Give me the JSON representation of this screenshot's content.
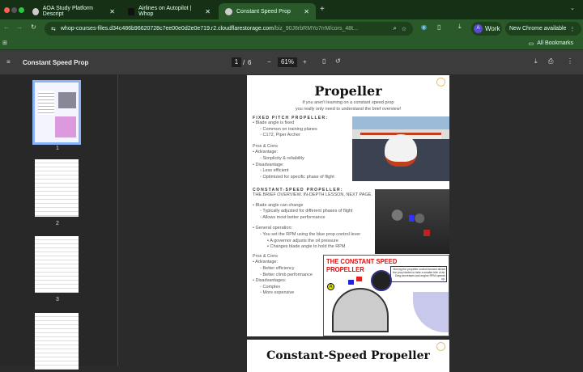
{
  "browser": {
    "tabs": [
      {
        "title": "AOA Study Platform Descript"
      },
      {
        "title": "Airlines on Autopilot | Whop"
      },
      {
        "title": "Constant Speed Prop"
      }
    ],
    "url": "whop-courses-files.d34c486b96620728c7ee00e0d2e0e719.r2.cloudflarestorage.com",
    "url_rest": "/biz_90J8rbRMYo7rrM/cors_48t...",
    "profile": "Work",
    "profile_initial": "A",
    "update_label": "New Chrome available",
    "bookmarks_label": "All Bookmarks"
  },
  "pdf": {
    "title": "Constant Speed Prop",
    "current_page": "1",
    "total_pages": "6",
    "zoom": "61%"
  },
  "thumbnails": [
    {
      "label": "1"
    },
    {
      "label": "2"
    },
    {
      "label": "3"
    }
  ],
  "page1": {
    "title": "Propeller",
    "subtitle_1": "if you aren't learning on a constant speed prop",
    "subtitle_2": "you really only need to understand the brief overview!",
    "fixed_heading": "FIXED PITCH PROPELLER:",
    "fixed_items": [
      "Blade angle is fixed",
      "Common on training planes",
      "C172, Piper Archer"
    ],
    "pros_cons": "Pros & Cons",
    "fixed_pc": [
      "Advantage:",
      "Simplicity & reliability",
      "Disadvantage:",
      "Less efficient",
      "Optimized for specific phase of flight"
    ],
    "cs_heading": "CONSTANT-SPEED PROPELLER:",
    "cs_sub": "THE BRIEF OVERVIEW. IN-DEPTH LESSON, NEXT PAGE.",
    "cs_items": [
      "Blade angle can change",
      "Typically adjusted for different phases of flight",
      "Allows most better performance",
      "General operation:",
      "You set the RPM using the blue prop control lever",
      "A governor adjusts the oil pressure",
      "Changes blade angle to hold the RPM"
    ],
    "cs_pc": [
      "Advantage:",
      "Better efficiency",
      "Better climb performance",
      "Disadvantages:",
      "Complex",
      "More expensive"
    ],
    "diagram_title": "THE CONSTANT SPEED PROPELLER",
    "diagram_note": "Moving the propeller control forward allows the prop blades to take a smaller bite of air. Drag decreases and engine RPM speeds up.",
    "diagram_marker": "A"
  },
  "page2": {
    "title": "Constant-Speed Propeller"
  }
}
